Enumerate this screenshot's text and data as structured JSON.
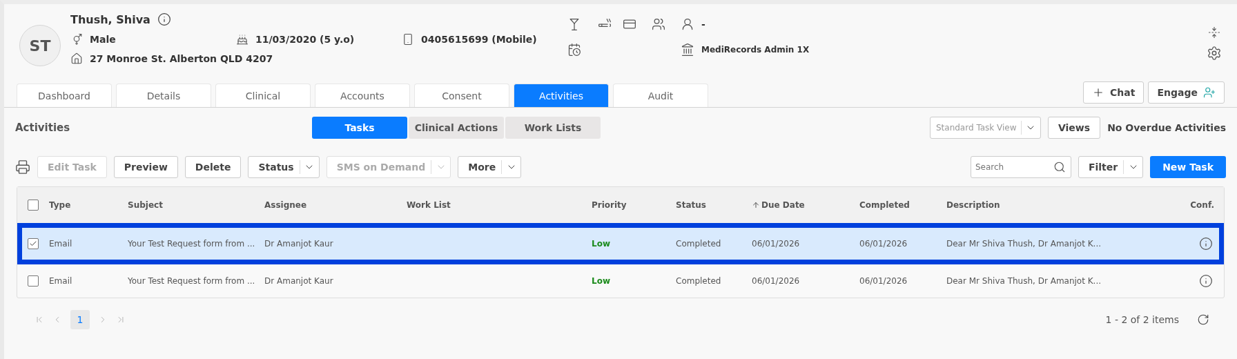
{
  "patient": {
    "initials": "ST",
    "name": "Thush, Shiva",
    "gender": "Male",
    "dob": "11/03/2020 (5 y.o)",
    "phone": "0405615699 (Mobile)",
    "address": "27 Monroe St. Alberton QLD 4207",
    "staff": "-",
    "practice": "MediRecords Admin 1X"
  },
  "tabs": [
    {
      "label": "Dashboard",
      "selected": false
    },
    {
      "label": "Details",
      "selected": false
    },
    {
      "label": "Clinical",
      "selected": false
    },
    {
      "label": "Accounts",
      "selected": false
    },
    {
      "label": "Consent",
      "selected": false
    },
    {
      "label": "Activities",
      "selected": true
    },
    {
      "label": "Audit",
      "selected": false
    }
  ],
  "header_actions": [
    {
      "label": "Chat",
      "kind": "chat"
    },
    {
      "label": "Engage",
      "kind": "engage"
    }
  ],
  "section_title": "Activities",
  "view_tabs": [
    {
      "label": "Tasks",
      "selected": true
    },
    {
      "label": "Clinical Actions",
      "selected": false
    },
    {
      "label": "Work Lists",
      "selected": false
    }
  ],
  "view_select": {
    "placeholder": "Standard Task View"
  },
  "views_button": "Views",
  "overdue": "No Overdue Activities",
  "toolbar": [
    {
      "label": "Edit Task",
      "kind": "button",
      "disabled": true
    },
    {
      "label": "Preview",
      "kind": "button",
      "disabled": false
    },
    {
      "label": "Delete",
      "kind": "button",
      "disabled": false
    },
    {
      "label": "Status",
      "kind": "split",
      "disabled": false
    },
    {
      "label": "SMS on Demand",
      "kind": "split",
      "disabled": true
    },
    {
      "label": "More",
      "kind": "split",
      "disabled": false
    }
  ],
  "search": {
    "placeholder": "Search"
  },
  "filter": "Filter",
  "new_task": "New Task",
  "table": {
    "all_checked": false,
    "columns": [
      {
        "label": "Type",
        "sorted": false
      },
      {
        "label": "Subject",
        "sorted": false
      },
      {
        "label": "Assignee",
        "sorted": false
      },
      {
        "label": "Work List",
        "sorted": false
      },
      {
        "label": "Priority",
        "sorted": false
      },
      {
        "label": "Status",
        "sorted": false
      },
      {
        "label": "Due Date",
        "sorted": true
      },
      {
        "label": "Completed",
        "sorted": false
      },
      {
        "label": "Description",
        "sorted": false
      },
      {
        "label": "Conf.",
        "sorted": false
      }
    ],
    "rows": [
      {
        "checked": true,
        "selected": true,
        "type": "Email",
        "subject": "Your Test Request form from ...",
        "assignee": "Dr Amanjot Kaur",
        "priority": "Low",
        "status": "Completed",
        "due_date": "06/01/2026",
        "completed": "06/01/2026",
        "description": "Dear Mr Shiva Thush, Dr Amanjot K..."
      },
      {
        "checked": false,
        "selected": false,
        "type": "Email",
        "subject": "Your Test Request form from ...",
        "assignee": "Dr Amanjot Kaur",
        "priority": "Low",
        "status": "Completed",
        "due_date": "06/01/2026",
        "completed": "06/01/2026",
        "description": "Dear Mr Shiva Thush, Dr Amanjot K..."
      }
    ]
  },
  "pagination": {
    "page": "1",
    "summary": "1 - 2 of 2 items"
  }
}
